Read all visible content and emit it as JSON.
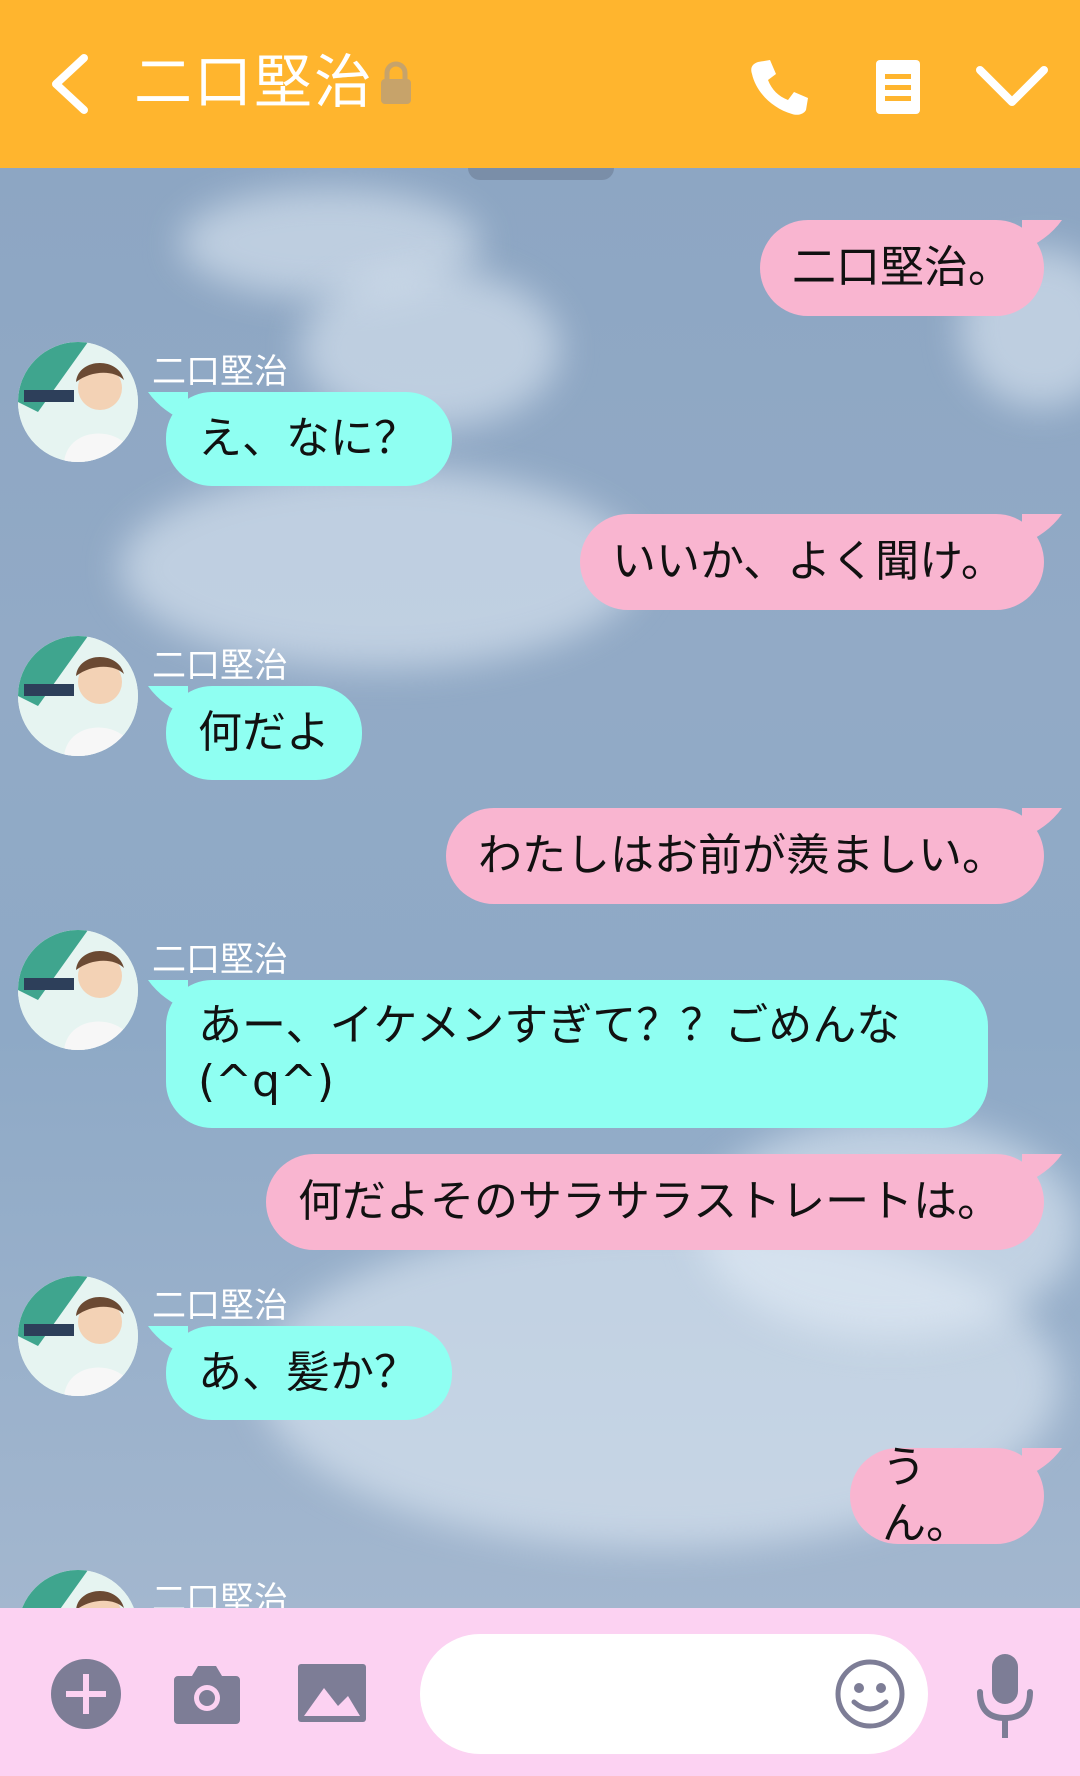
{
  "header": {
    "title": "二口堅治",
    "background": "#ffb52e",
    "icons": [
      "back-icon",
      "lock-icon",
      "phone-icon",
      "memo-icon",
      "chevron-down-icon"
    ]
  },
  "chat": {
    "me_bubble_color": "#f9b5d0",
    "them_bubble_color": "#8ffff2",
    "messages": [
      {
        "from": "me",
        "text": "二口堅治。"
      },
      {
        "from": "them",
        "sender": "二口堅治",
        "text": "え、なに？"
      },
      {
        "from": "me",
        "text": "いいか、よく聞け。"
      },
      {
        "from": "them",
        "sender": "二口堅治",
        "text": "何だよ"
      },
      {
        "from": "me",
        "text": "わたしはお前が羨ましい。"
      },
      {
        "from": "them",
        "sender": "二口堅治",
        "text": "あー、イケメンすぎて？？ごめんな\n(^q^)"
      },
      {
        "from": "me",
        "text": "何だよそのサラサラストレートは。"
      },
      {
        "from": "them",
        "sender": "二口堅治",
        "text": "あ、髪か？"
      },
      {
        "from": "me",
        "text": "うん。"
      },
      {
        "from": "them",
        "sender": "二口堅治",
        "text": ""
      }
    ]
  },
  "composer": {
    "placeholder": "",
    "value": "",
    "background": "#fcd2f2",
    "icons": [
      "plus-icon",
      "camera-icon",
      "image-icon",
      "emoji-icon",
      "mic-icon"
    ]
  }
}
